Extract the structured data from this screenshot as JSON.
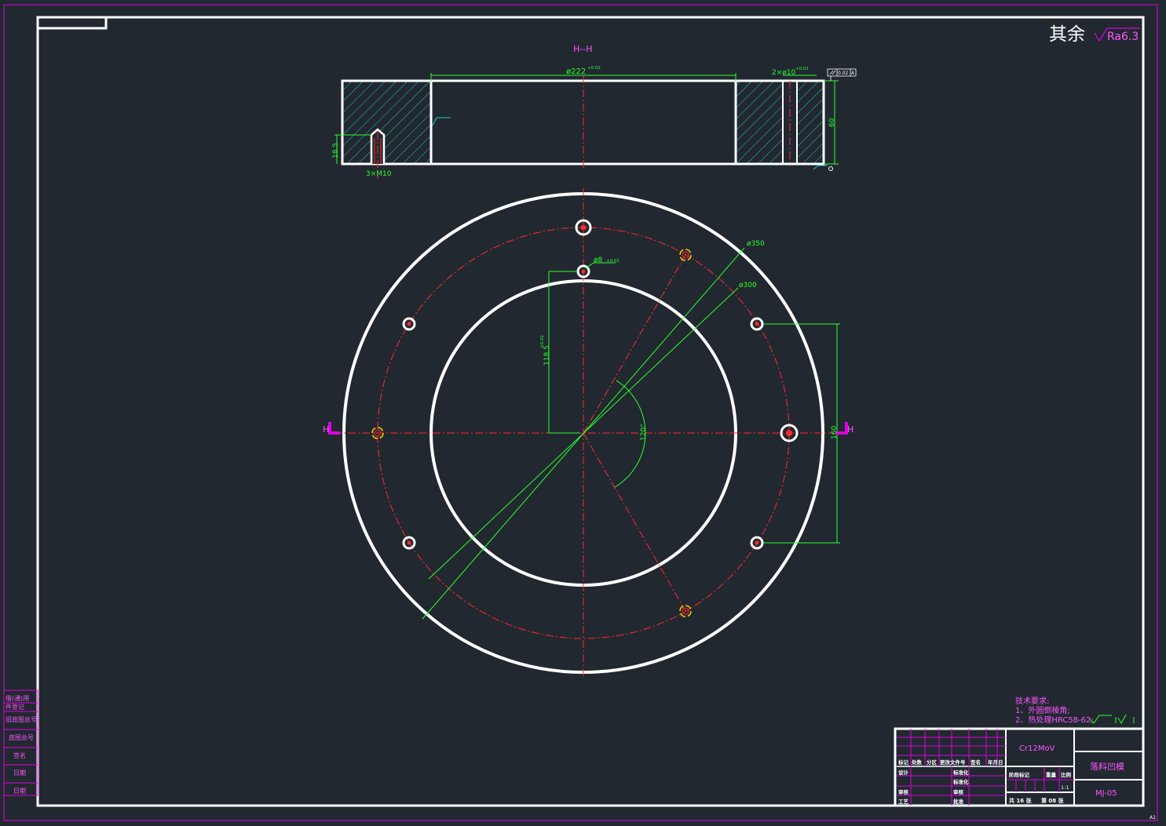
{
  "drawing": {
    "roughness_note": "其余",
    "roughness_value": "Ra6.3",
    "section_label": "H--H",
    "view_marker_left": "H",
    "view_marker_right": "H"
  },
  "dimensions": {
    "bore": "ø222",
    "bore_tol": "+0.02",
    "holes_top": "2×ø10",
    "holes_top_tol": "+0.01",
    "thickness": "60",
    "thread_depth": "18.5",
    "thread": "3×M10",
    "flatness": "0.02",
    "datum": "A",
    "outer_circle": "ø350",
    "bolt_circle": "ø300",
    "pin_hole": "ø8",
    "pin_hole_tol": "+0.02",
    "offset_vertical": "118.5",
    "offset_tol": "±0.02",
    "angle": "120°",
    "span_vertical": "160"
  },
  "tech_requirements": {
    "heading": "技术要求:",
    "items": [
      "1、外圆倒棱角;",
      "2、热处理HRC58-62;"
    ]
  },
  "title_block": {
    "material": "Cr12MoV",
    "part_name": "落料凹模",
    "drawing_no": "MJ-05",
    "scale": "1:1",
    "sheet_total": "共 16 张",
    "sheet_index": "第 08 张",
    "stage_headers": [
      "阶段标记",
      "重量",
      "比例"
    ],
    "row_headers": [
      "标记",
      "处数",
      "分区",
      "更改文件号",
      "签名",
      "年月日"
    ],
    "signatures": [
      "设计",
      "标准化",
      "审核",
      "工艺",
      "批准"
    ],
    "signature_roles": [
      "标准化",
      "审核",
      "批准"
    ]
  },
  "side_block": {
    "labels": [
      "借(通)用",
      "件登记",
      "旧底图总号",
      "底图总号",
      "签名",
      "日期",
      "日期"
    ]
  },
  "corner_mark": "A1"
}
